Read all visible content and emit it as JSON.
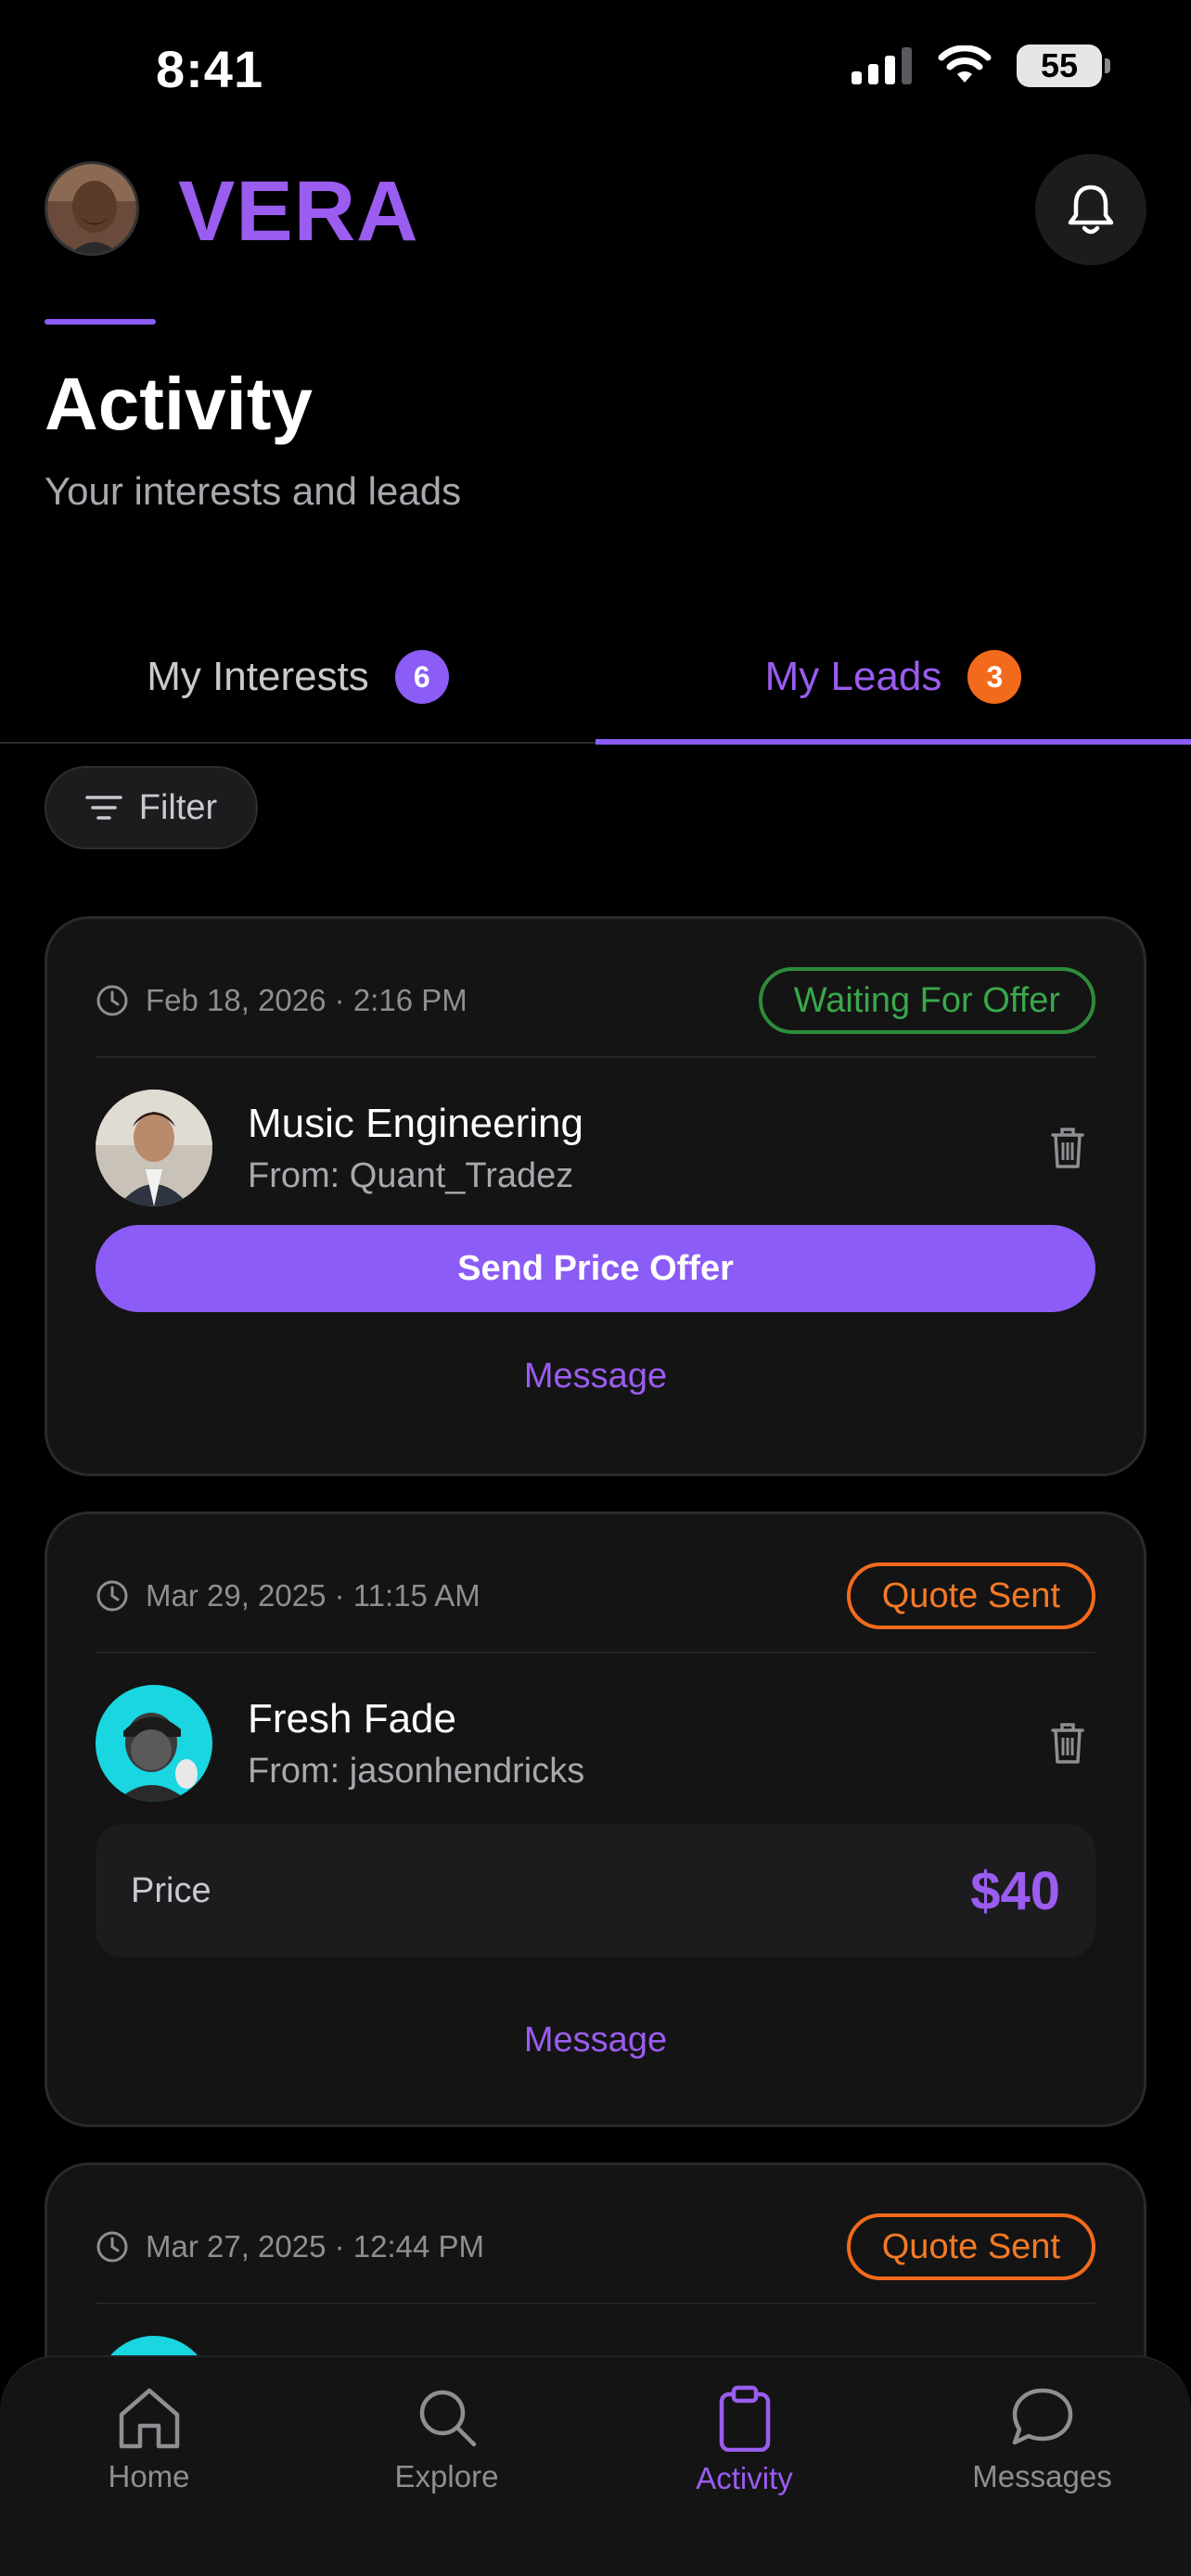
{
  "status_bar": {
    "time": "8:41",
    "battery": "55"
  },
  "header": {
    "brand": "VERA"
  },
  "page": {
    "title": "Activity",
    "subtitle": "Your interests and leads"
  },
  "tabs": [
    {
      "label": "My Interests",
      "badge": "6",
      "badge_color": "#8b5cf6",
      "active": false
    },
    {
      "label": "My Leads",
      "badge": "3",
      "badge_color": "#f26a1b",
      "active": true
    }
  ],
  "filter": {
    "label": "Filter"
  },
  "leads": [
    {
      "date": "Feb 18, 2026 · 2:16 PM",
      "status": "Waiting For Offer",
      "status_color": "#39a84a",
      "title": "Music Engineering",
      "from": "From: Quant_Tradez",
      "action": "Send Price Offer",
      "message": "Message"
    },
    {
      "date": "Mar 29, 2025 · 11:15 AM",
      "status": "Quote Sent",
      "status_color": "#f47a26",
      "title": "Fresh Fade",
      "from": "From: jasonhendricks",
      "price_label": "Price",
      "price": "$40",
      "message": "Message"
    },
    {
      "date": "Mar 27, 2025 · 12:44 PM",
      "status": "Quote Sent",
      "status_color": "#f47a26"
    }
  ],
  "bottom_nav": [
    {
      "label": "Home",
      "icon": "home-icon",
      "active": false
    },
    {
      "label": "Explore",
      "icon": "search-icon",
      "active": false
    },
    {
      "label": "Activity",
      "icon": "clipboard-icon",
      "active": true
    },
    {
      "label": "Messages",
      "icon": "chat-bubble-icon",
      "active": false
    }
  ],
  "colors": {
    "accent": "#8b5cf6",
    "background": "#000000",
    "card": "#141414"
  }
}
